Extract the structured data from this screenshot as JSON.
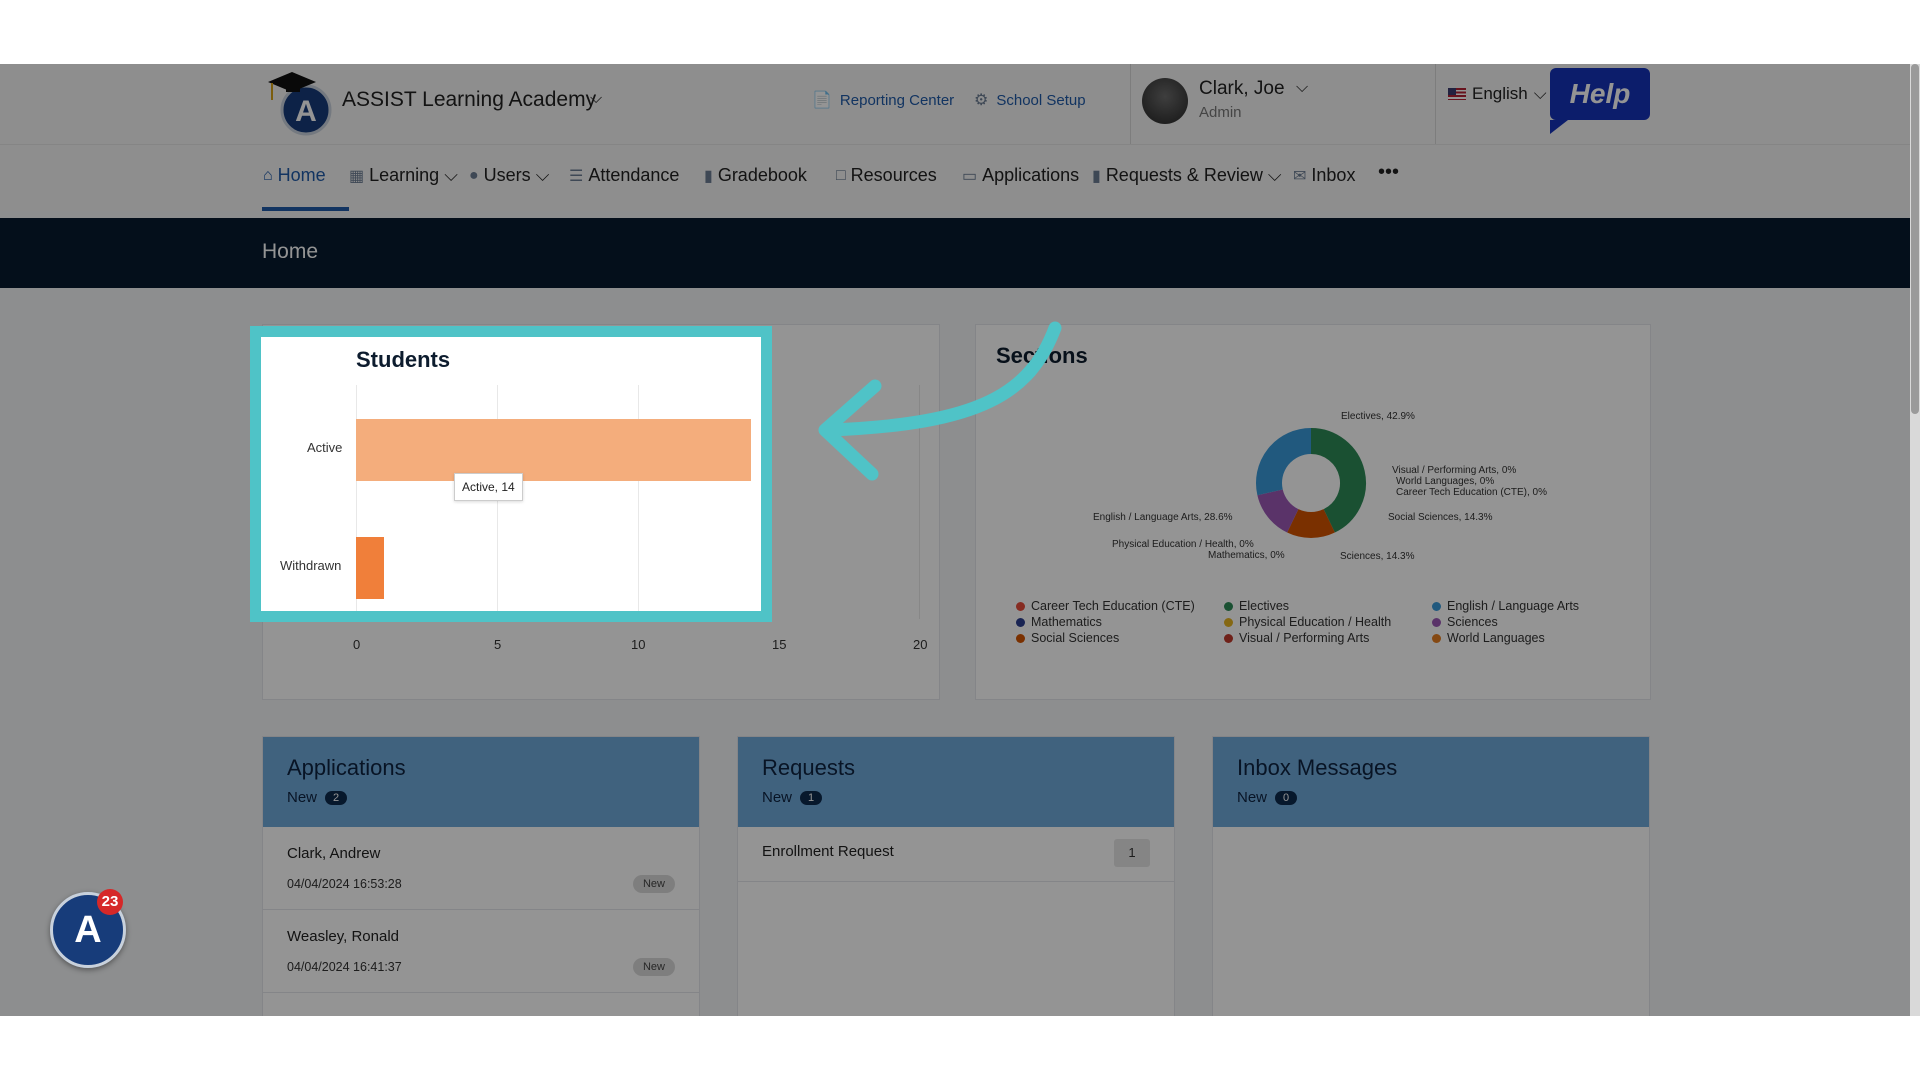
{
  "header": {
    "org_name": "ASSIST Learning Academy",
    "reporting_center": "Reporting Center",
    "school_setup": "School Setup",
    "user_name": "Clark, Joe",
    "user_role": "Admin",
    "language": "English",
    "help": "Help"
  },
  "nav": {
    "home": "Home",
    "learning": "Learning",
    "users": "Users",
    "attendance": "Attendance",
    "gradebook": "Gradebook",
    "resources": "Resources",
    "applications": "Applications",
    "requests_review": "Requests & Review",
    "inbox": "Inbox",
    "more": "•••"
  },
  "page_title": "Home",
  "students_card": {
    "title": "Students",
    "tooltip": "Active, 14",
    "x_ticks": [
      "0",
      "5",
      "10",
      "15",
      "20"
    ]
  },
  "sections_card": {
    "title": "Sections",
    "labels": {
      "electives": "Electives, 42.9%",
      "visual": "Visual / Performing Arts, 0%",
      "world": "World Languages, 0%",
      "cte": "Career Tech Education (CTE), 0%",
      "social": "Social Sciences, 14.3%",
      "english": "English / Language Arts, 28.6%",
      "pe": "Physical Education / Health, 0%",
      "math": "Mathematics, 0%",
      "sciences": "Sciences, 14.3%"
    },
    "legend": [
      {
        "label": "Career Tech Education (CTE)",
        "color": "#e74c3c"
      },
      {
        "label": "Electives",
        "color": "#2e8b57"
      },
      {
        "label": "English / Language Arts",
        "color": "#3a9ad9"
      },
      {
        "label": "Mathematics",
        "color": "#2c3e8f"
      },
      {
        "label": "Physical Education / Health",
        "color": "#e6b422"
      },
      {
        "label": "Sciences",
        "color": "#9b59b6"
      },
      {
        "label": "Social Sciences",
        "color": "#d35400"
      },
      {
        "label": "Visual / Performing Arts",
        "color": "#c0392b"
      },
      {
        "label": "World Languages",
        "color": "#e67e22"
      }
    ]
  },
  "chart_data": [
    {
      "type": "bar",
      "orientation": "horizontal",
      "title": "Students",
      "categories": [
        "Active",
        "Withdrawn"
      ],
      "values": [
        14,
        1
      ],
      "xlim": [
        0,
        20
      ],
      "x_ticks": [
        0,
        5,
        10,
        15,
        20
      ],
      "colors": [
        "#f4ad7c",
        "#f07f3a"
      ]
    },
    {
      "type": "pie",
      "title": "Sections",
      "categories": [
        "Electives",
        "Social Sciences",
        "Sciences",
        "English / Language Arts",
        "Career Tech Education (CTE)",
        "Mathematics",
        "Physical Education / Health",
        "Visual / Performing Arts",
        "World Languages"
      ],
      "values": [
        42.9,
        14.3,
        14.3,
        28.6,
        0,
        0,
        0,
        0,
        0
      ],
      "colors": [
        "#2e8b57",
        "#d35400",
        "#9b59b6",
        "#3a9ad9",
        "#e74c3c",
        "#2c3e8f",
        "#e6b422",
        "#c0392b",
        "#e67e22"
      ]
    }
  ],
  "applications": {
    "title": "Applications",
    "new_label": "New",
    "count": "2",
    "rows": [
      {
        "name": "Clark, Andrew",
        "date": "04/04/2024 16:53:28",
        "status": "New"
      },
      {
        "name": "Weasley, Ronald",
        "date": "04/04/2024 16:41:37",
        "status": "New"
      }
    ]
  },
  "requests": {
    "title": "Requests",
    "new_label": "New",
    "count": "1",
    "row_label": "Enrollment Request",
    "row_count": "1"
  },
  "inbox": {
    "title": "Inbox Messages",
    "new_label": "New",
    "count": "0"
  },
  "fab_badge": "23"
}
